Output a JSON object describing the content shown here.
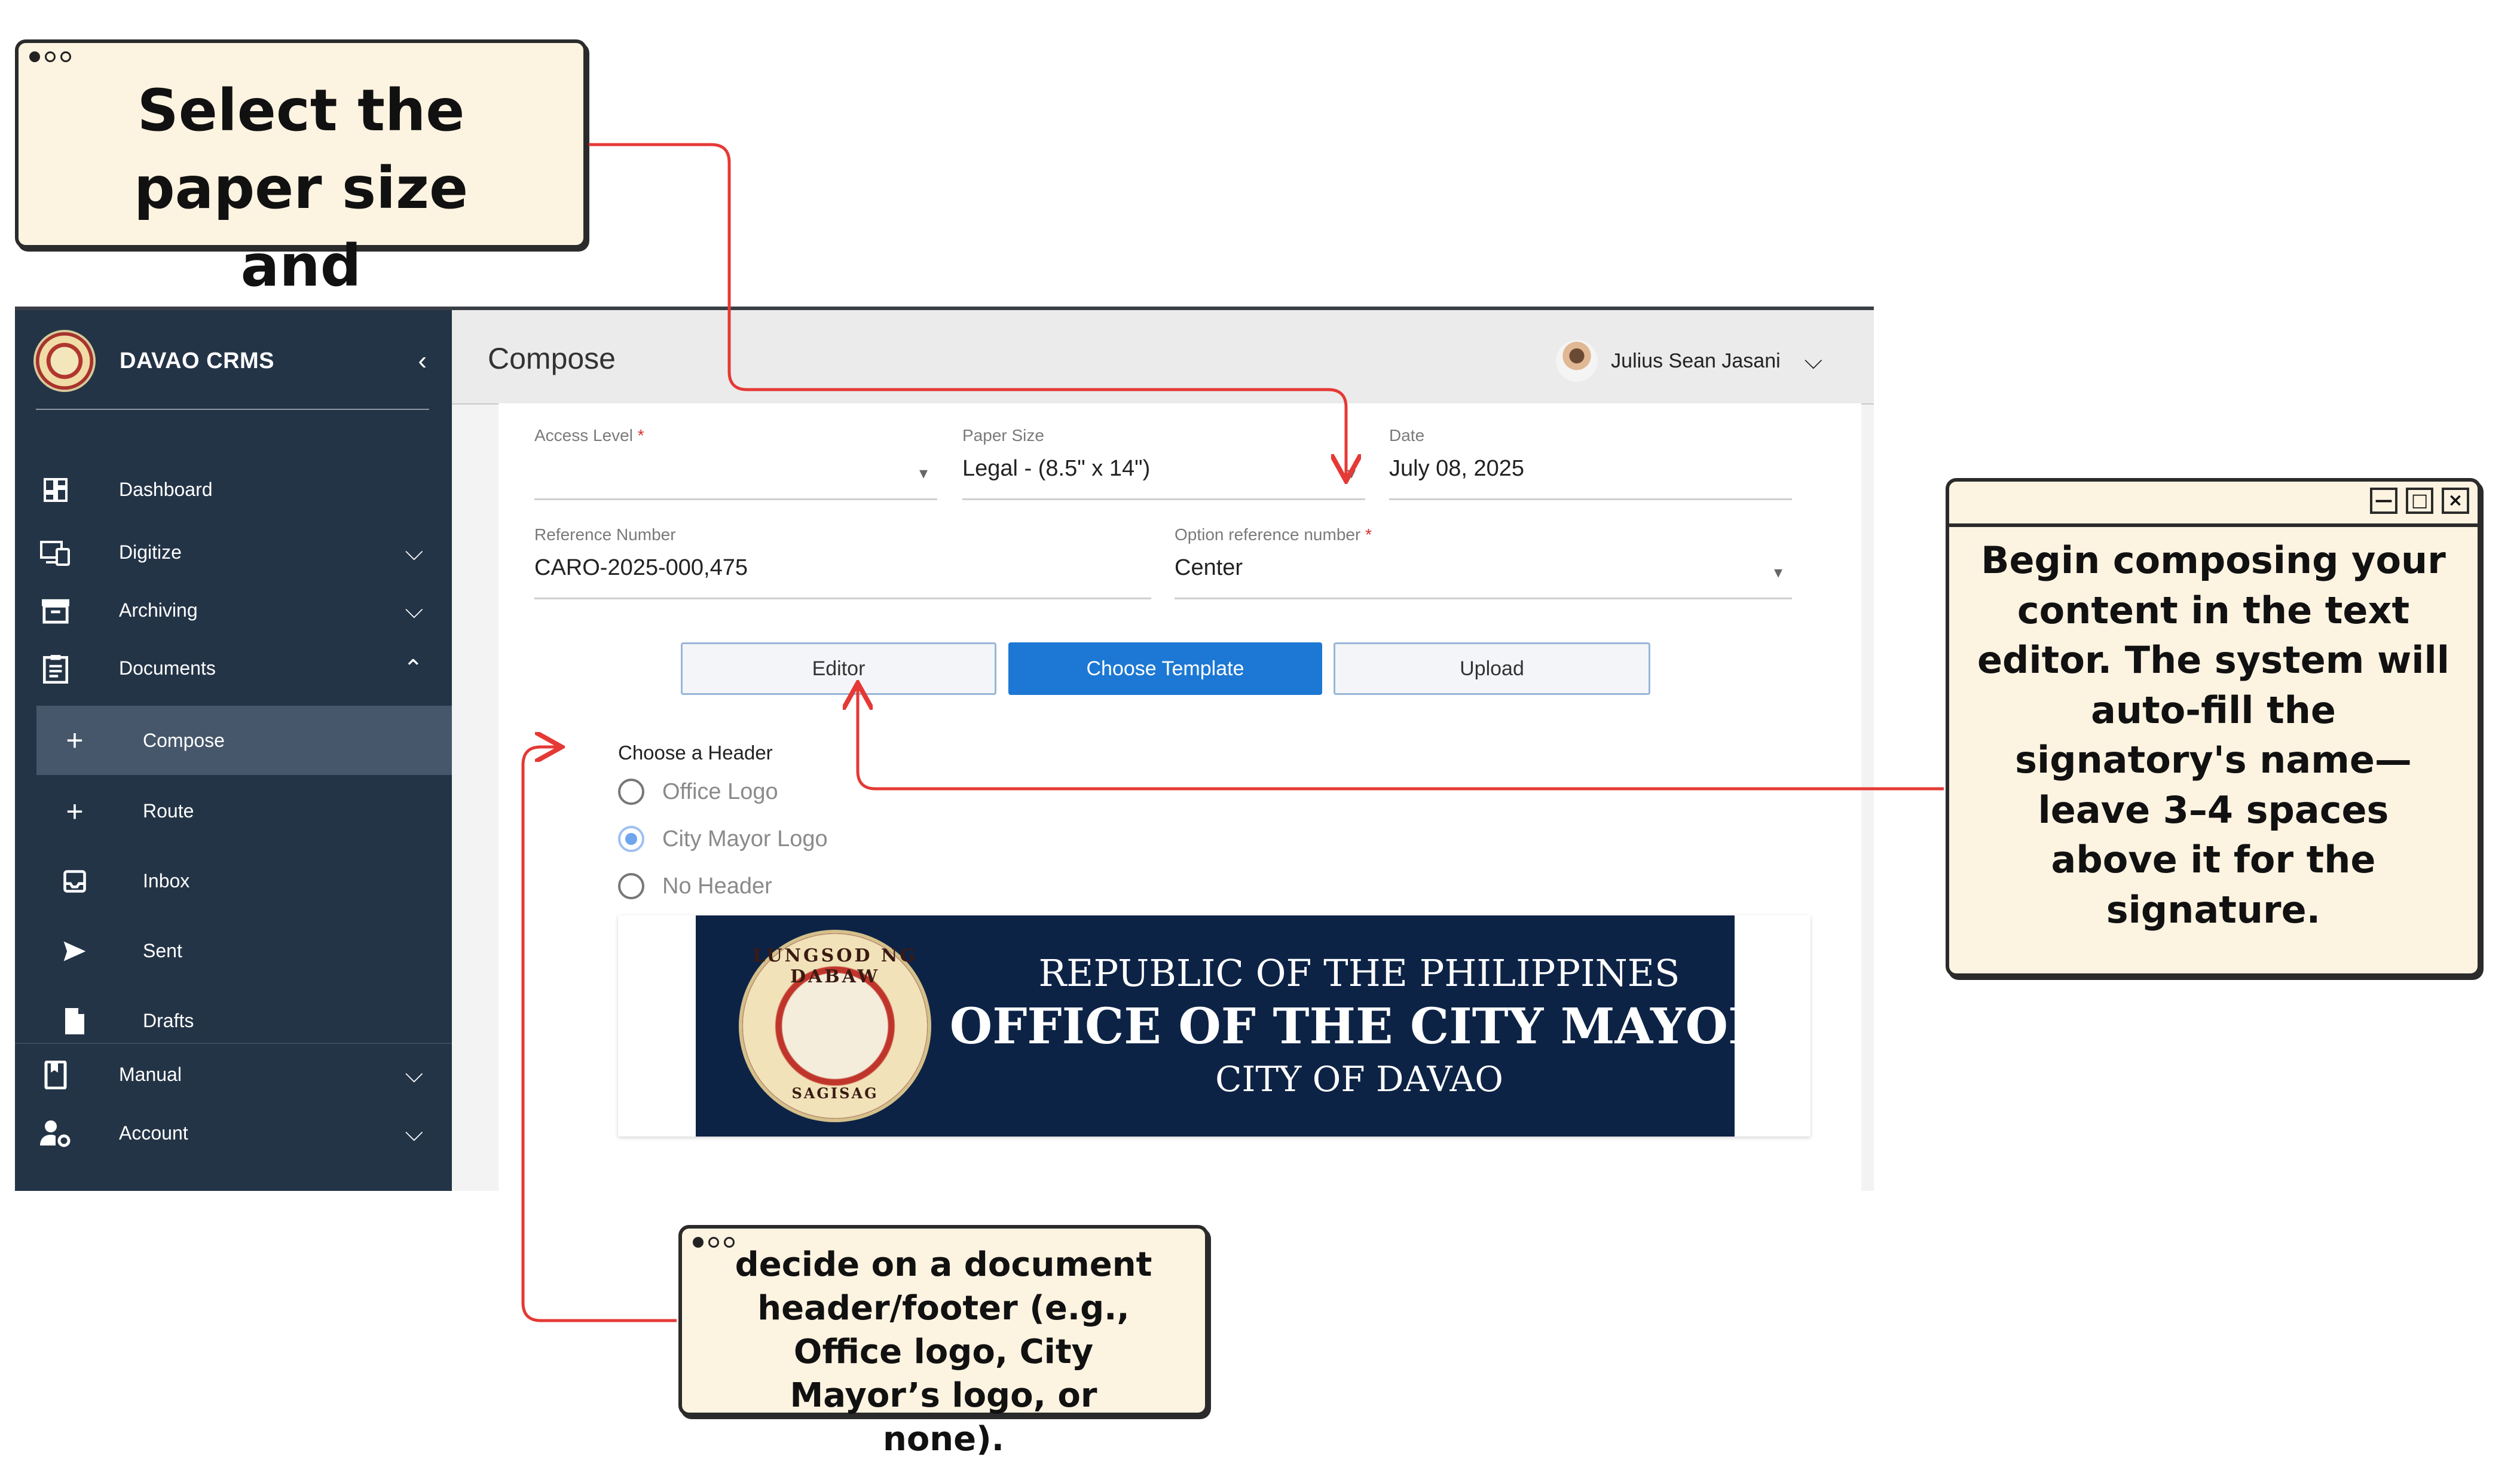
{
  "sidebar": {
    "brand": "DAVAO CRMS",
    "items": [
      {
        "label": "Dashboard",
        "icon": "dashboard-icon"
      },
      {
        "label": "Digitize",
        "icon": "devices-icon"
      },
      {
        "label": "Archiving",
        "icon": "archive-icon"
      },
      {
        "label": "Documents",
        "icon": "clipboard-icon"
      },
      {
        "label": "Compose",
        "icon": "plus-icon"
      },
      {
        "label": "Route",
        "icon": "plus-icon"
      },
      {
        "label": "Inbox",
        "icon": "inbox-icon"
      },
      {
        "label": "Sent",
        "icon": "send-icon"
      },
      {
        "label": "Drafts",
        "icon": "file-icon"
      },
      {
        "label": "Manual",
        "icon": "book-icon"
      },
      {
        "label": "Account",
        "icon": "user-settings-icon"
      }
    ]
  },
  "header": {
    "title": "Compose",
    "user_name": "Julius Sean Jasani"
  },
  "form": {
    "access_level": {
      "label": "Access Level",
      "required_mark": "*",
      "value": ""
    },
    "paper_size": {
      "label": "Paper Size",
      "value": "Legal - (8.5\" x 14\")"
    },
    "date": {
      "label": "Date",
      "value": "July 08, 2025"
    },
    "reference_number": {
      "label": "Reference Number",
      "value": "CARO-2025-000,475"
    },
    "option_reference": {
      "label": "Option reference number",
      "required_mark": "*",
      "value": "Center"
    }
  },
  "mode_buttons": {
    "editor": "Editor",
    "choose_template": "Choose Template",
    "upload": "Upload"
  },
  "header_options": {
    "label": "Choose a Header",
    "options": [
      "Office Logo",
      "City Mayor Logo",
      "No Header"
    ],
    "selected": "City Mayor Logo"
  },
  "banner": {
    "seal_top": "LUNGSOD NG DABAW",
    "seal_bottom": "SAGISAG",
    "line1": "REPUBLIC OF THE PHILIPPINES",
    "line2": "OFFICE OF THE CITY MAYOR",
    "line3": "CITY OF DAVAO"
  },
  "callouts": {
    "paper": "Select the paper size and",
    "editor": "Begin composing your content in the text editor. The system will auto-fill the signatory's name—leave 3–4 spaces above it for the signature.",
    "header": "decide on a document header/footer (e.g., Office logo, City Mayor’s logo, or none)."
  },
  "colors": {
    "sidebar": "#243447",
    "accent": "#1c78d4",
    "callout": "#fdf3e1",
    "arrow": "#e53935",
    "banner": "#0d2346"
  }
}
